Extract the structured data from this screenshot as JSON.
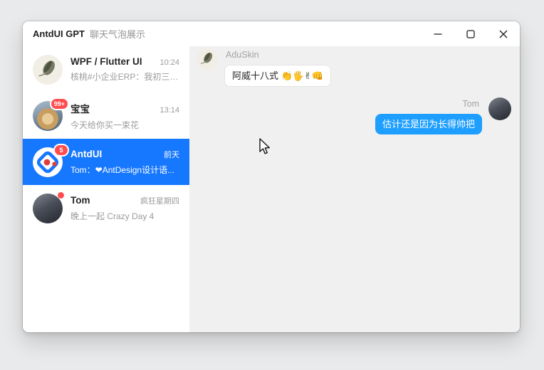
{
  "window": {
    "title_app": "AntdUI GPT",
    "title_sub": "聊天气泡展示",
    "controls": {
      "minimize": "minimize",
      "maximize": "maximize",
      "close": "close"
    }
  },
  "colors": {
    "sidebar_selected_blue": "#1677FF",
    "outgoing_bubble_blue": "#1E9FFF",
    "badge_red": "#FF4D4F",
    "chat_background": "#F0F0F1"
  },
  "sidebar": {
    "items": [
      {
        "name": "WPF / Flutter UI",
        "time": "10:24",
        "preview": "核桃#小企业ERP：我初三就...",
        "badge": "",
        "selected": false
      },
      {
        "name": "宝宝",
        "time": "13:14",
        "preview": "今天给你买一束花",
        "badge": "99+",
        "selected": false
      },
      {
        "name": "AntdUI",
        "time": "前天",
        "preview": "Tom：❤AntDesign设计语...",
        "badge": "5",
        "selected": true
      },
      {
        "name": "Tom",
        "time": "疯狂星期四",
        "preview": "晚上一起 Crazy Day 4",
        "badge": "dot",
        "selected": false
      }
    ]
  },
  "chat": {
    "messages": [
      {
        "author": "AduSkin",
        "side": "left",
        "text": "阿威十八式 👏🖐✌👊"
      },
      {
        "author": "Tom",
        "side": "right",
        "text": "估计还是因为长得帅把"
      }
    ]
  }
}
